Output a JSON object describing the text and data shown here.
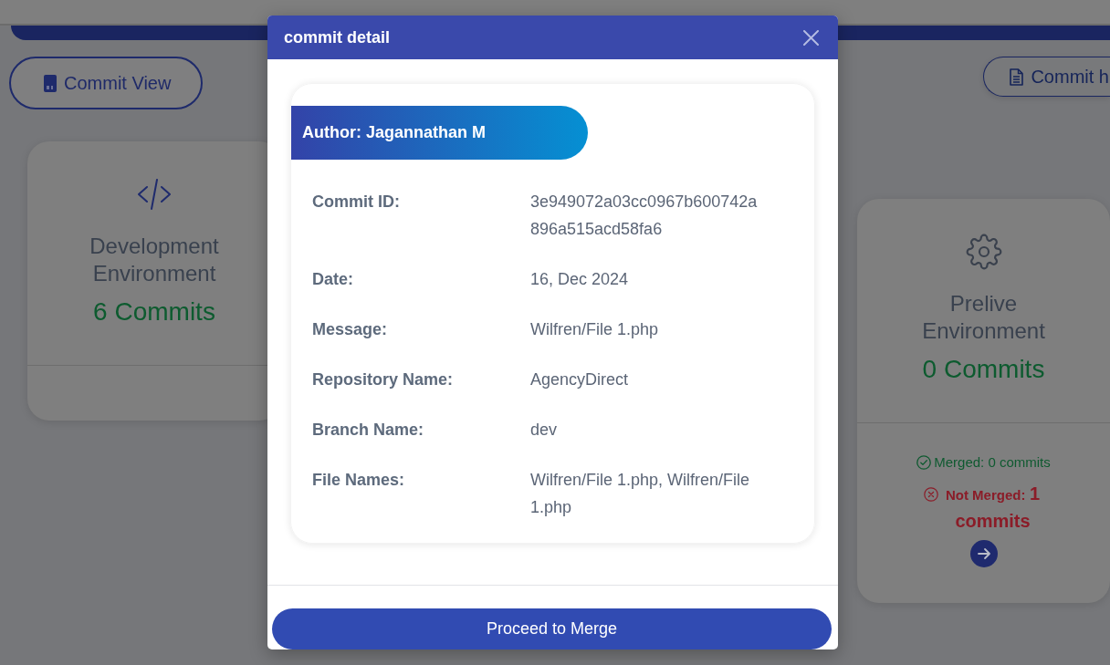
{
  "toolbar": {
    "buttons": [
      {
        "label": "Commit View"
      },
      {
        "label": "Commit h"
      }
    ]
  },
  "environments": [
    {
      "kind": "development",
      "title": "Development Environment",
      "count": "6 Commits"
    },
    {
      "kind": "prelive",
      "title": "Prelive Environment",
      "count": "0 Commits",
      "merge_status": {
        "merged": "Merged: 0 commits",
        "not_merged_label": "Not Merged:",
        "not_merged_value": "1 commits"
      }
    }
  ],
  "dialog": {
    "title": "commit detail",
    "author": "Author: Jagannathan M",
    "fields": [
      {
        "label": "Commit ID:",
        "value": "3e949072a03cc0967b600742a896a515acd58fa6"
      },
      {
        "label": "Date:",
        "value": "16, Dec 2024"
      },
      {
        "label": "Message:",
        "value": "Wilfren/File 1.php"
      },
      {
        "label": "Repository Name:",
        "value": "AgencyDirect"
      },
      {
        "label": "Branch Name:",
        "value": "dev"
      },
      {
        "label": "File Names:",
        "value": "Wilfren/File 1.php, Wilfren/File 1.php"
      }
    ],
    "button": "Proceed to Merge"
  }
}
